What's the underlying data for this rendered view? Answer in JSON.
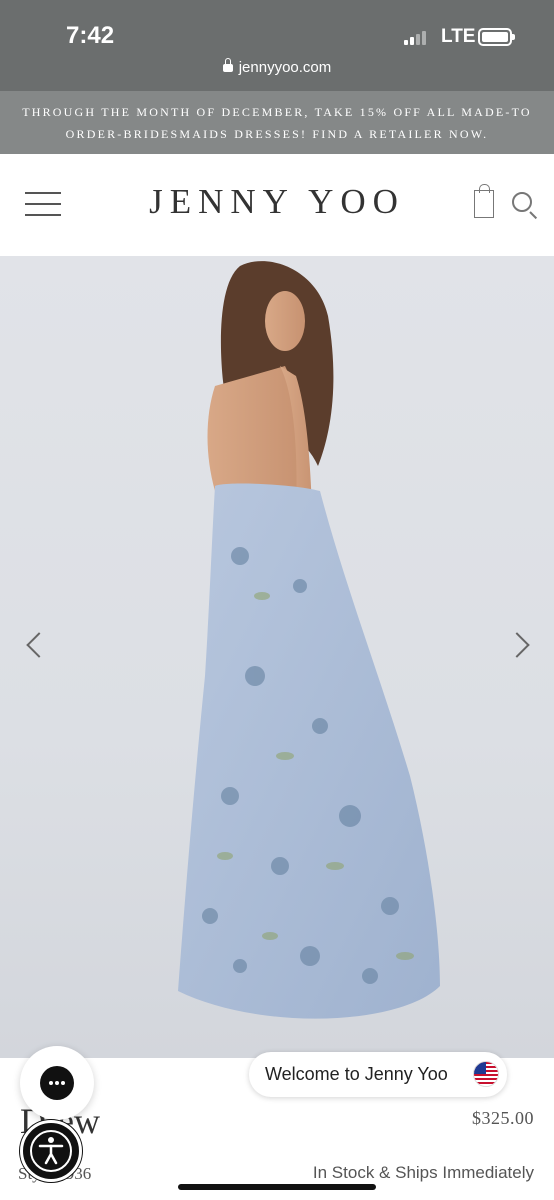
{
  "status_bar": {
    "time": "7:42",
    "network": "LTE",
    "url": "jennyyoo.com"
  },
  "promo": {
    "text": "Through the month of December, take 15% off all Made-to Order-Bridesmaids Dresses! Find a retailer now."
  },
  "header": {
    "logo": "JENNY YOO"
  },
  "product": {
    "name": "Drew",
    "style": "Style 1936",
    "price": "$325.00",
    "stock_status": "In Stock & Ships Immediately"
  },
  "chat": {
    "welcome_text": "Welcome to Jenny Yoo"
  },
  "colors": {
    "status_bar_bg": "#6b6e6e",
    "promo_bg": "#858888",
    "dress": "#aebfd8"
  },
  "icons": [
    "lock-icon",
    "menu-icon",
    "shopping-bag-icon",
    "search-icon",
    "chevron-left-icon",
    "chevron-right-icon",
    "chat-icon",
    "us-flag-icon",
    "accessibility-icon"
  ]
}
